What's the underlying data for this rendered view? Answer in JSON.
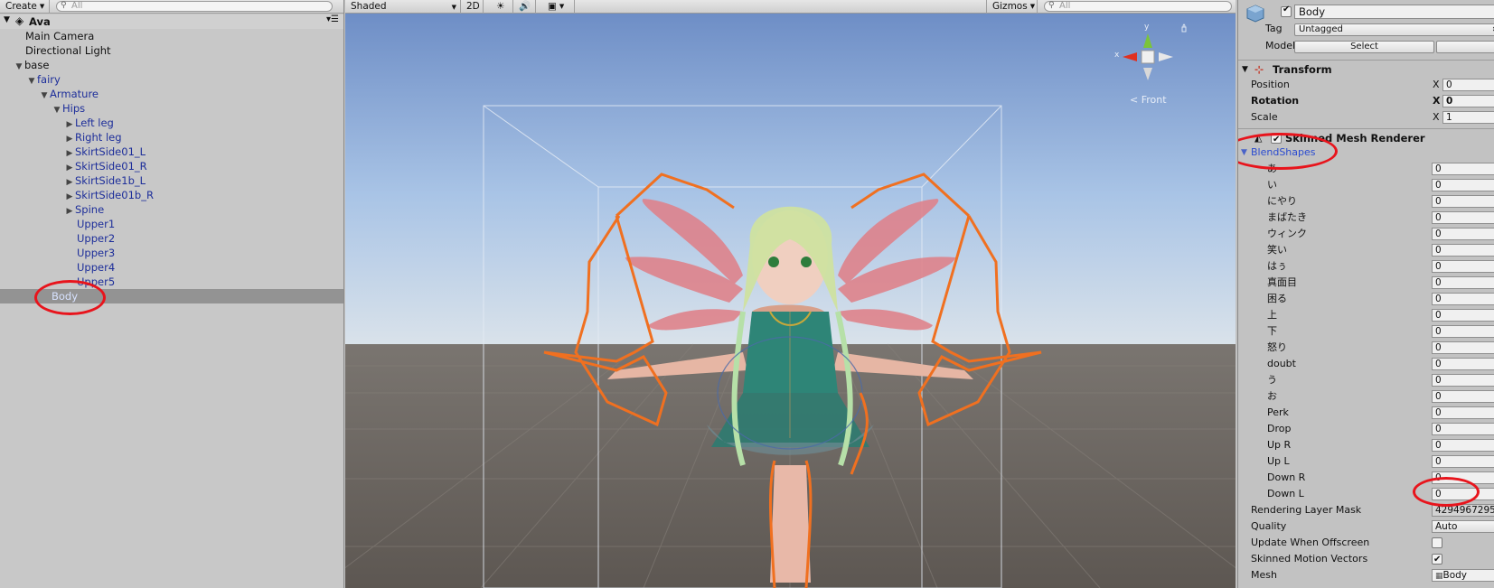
{
  "hierarchy": {
    "create_label": "Create",
    "search_placeholder": "All",
    "scene_name": "Ava",
    "items": [
      {
        "label": "Main Camera"
      },
      {
        "label": "Directional Light"
      },
      {
        "label": "base"
      },
      {
        "label": "fairy"
      },
      {
        "label": "Armature"
      },
      {
        "label": "Hips"
      },
      {
        "label": "Left leg"
      },
      {
        "label": "Right leg"
      },
      {
        "label": "SkirtSide01_L"
      },
      {
        "label": "SkirtSide01_R"
      },
      {
        "label": "SkirtSide1b_L"
      },
      {
        "label": "SkirtSide01b_R"
      },
      {
        "label": "Spine"
      },
      {
        "label": "Upper1"
      },
      {
        "label": "Upper2"
      },
      {
        "label": "Upper3"
      },
      {
        "label": "Upper4"
      },
      {
        "label": "Upper5"
      },
      {
        "label": "Body"
      }
    ]
  },
  "scene": {
    "shading_mode": "Shaded",
    "mode_2d": "2D",
    "gizmos_label": "Gizmos",
    "search_placeholder": "All",
    "view_label": "Front",
    "axis_y": "y",
    "axis_x": "x"
  },
  "inspector": {
    "object_name": "Body",
    "tag_label": "Tag",
    "tag_value": "Untagged",
    "model_label": "Model",
    "select_label": "Select",
    "transform_title": "Transform",
    "position_label": "Position",
    "rotation_label": "Rotation",
    "scale_label": "Scale",
    "axis_x": "X",
    "position_x": "0",
    "rotation_x": "0",
    "scale_x": "1",
    "smr_title": "Skinned Mesh Renderer",
    "blendshapes_label": "BlendShapes",
    "blendshapes": [
      {
        "name": "あ",
        "value": "0"
      },
      {
        "name": "い",
        "value": "0"
      },
      {
        "name": "にやり",
        "value": "0"
      },
      {
        "name": "まばたき",
        "value": "0"
      },
      {
        "name": "ウィンク",
        "value": "0"
      },
      {
        "name": "笑い",
        "value": "0"
      },
      {
        "name": "はぅ",
        "value": "0"
      },
      {
        "name": "真面目",
        "value": "0"
      },
      {
        "name": "困る",
        "value": "0"
      },
      {
        "name": "上",
        "value": "0"
      },
      {
        "name": "下",
        "value": "0"
      },
      {
        "name": "怒り",
        "value": "0"
      },
      {
        "name": "doubt",
        "value": "0"
      },
      {
        "name": "う",
        "value": "0"
      },
      {
        "name": "お",
        "value": "0"
      },
      {
        "name": "Perk",
        "value": "0"
      },
      {
        "name": "Drop",
        "value": "0"
      },
      {
        "name": "Up R",
        "value": "0"
      },
      {
        "name": "Up L",
        "value": "0"
      },
      {
        "name": "Down R",
        "value": "0"
      },
      {
        "name": "Down L",
        "value": "0"
      }
    ],
    "rendering_layer_mask_label": "Rendering Layer Mask",
    "rendering_layer_mask_value": "4294967295",
    "quality_label": "Quality",
    "quality_value": "Auto",
    "update_offscreen_label": "Update When Offscreen",
    "update_offscreen_checked": false,
    "skinned_motion_vectors_label": "Skinned Motion Vectors",
    "skinned_motion_vectors_checked": true,
    "mesh_label": "Mesh",
    "mesh_value": "Body"
  },
  "colors": {
    "annotation": "#e8141c",
    "selection_outline": "#f07020",
    "sky_top": "#7593c8",
    "ground": "#6a6560"
  }
}
